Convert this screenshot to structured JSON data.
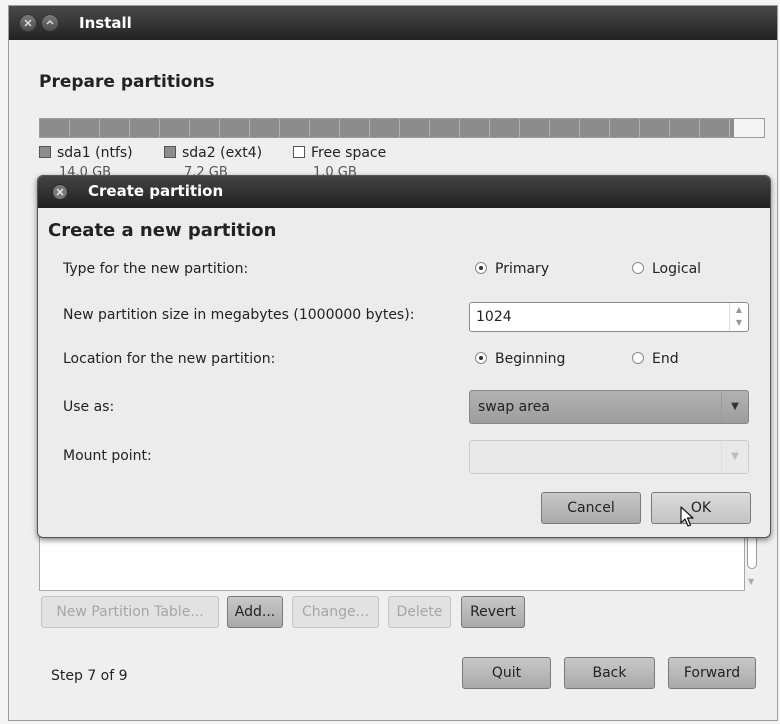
{
  "window": {
    "title": "Install"
  },
  "page": {
    "title": "Prepare partitions"
  },
  "legend": [
    {
      "name": "sda1 (ntfs)",
      "size": "14.0 GB",
      "color": "#8c8c8c"
    },
    {
      "name": "sda2 (ext4)",
      "size": "7.2 GB",
      "color": "#8c8c8c"
    },
    {
      "name": "Free space",
      "size": "1.0 GB",
      "color": "#ffffff"
    }
  ],
  "dialog": {
    "title": "Create partition",
    "heading": "Create a new partition",
    "type_label": "Type for the new partition:",
    "type_options": [
      "Primary",
      "Logical"
    ],
    "type_selected": "Primary",
    "size_label": "New partition size in megabytes (1000000 bytes):",
    "size_value": "1024",
    "location_label": "Location for the new partition:",
    "location_options": [
      "Beginning",
      "End"
    ],
    "location_selected": "Beginning",
    "use_as_label": "Use as:",
    "use_as_value": "swap area",
    "mount_label": "Mount point:",
    "mount_value": "",
    "cancel_label": "Cancel",
    "ok_label": "OK"
  },
  "partition_buttons": {
    "new_table": "New Partition Table...",
    "add": "Add...",
    "change": "Change...",
    "delete": "Delete",
    "revert": "Revert"
  },
  "footer": {
    "step": "Step 7 of 9",
    "quit": "Quit",
    "back": "Back",
    "forward": "Forward"
  },
  "icons": {
    "close": "close-icon",
    "dropdown": "dropdown-arrow-icon",
    "cursor": "mouse-pointer-icon"
  },
  "colors": {
    "titlebar": "#222222",
    "button": "#b5b5b5",
    "background": "#efefef"
  }
}
